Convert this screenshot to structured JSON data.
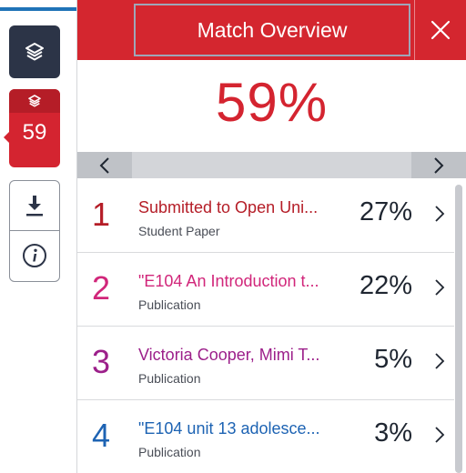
{
  "sidebar": {
    "layers_icon": "layers-icon",
    "score_layers_icon": "layers-icon",
    "score": "59",
    "download_icon": "download-icon",
    "info_icon": "info-icon"
  },
  "header": {
    "title": "Match Overview",
    "close_icon": "close-icon"
  },
  "overall_match": "59%",
  "navigation": {
    "prev_icon": "chevron-left-icon",
    "next_icon": "chevron-right-icon"
  },
  "matches": [
    {
      "rank": "1",
      "title": "Submitted to Open Uni...",
      "type": "Student Paper",
      "percent": "27%",
      "color": "#b51d27"
    },
    {
      "rank": "2",
      "title": "\"E104 An Introduction t...",
      "type": "Publication",
      "percent": "22%",
      "color": "#d1267a"
    },
    {
      "rank": "3",
      "title": "Victoria Cooper, Mimi T...",
      "type": "Publication",
      "percent": "5%",
      "color": "#9c1f8a"
    },
    {
      "rank": "4",
      "title": "\"E104 unit 13 adolesce...",
      "type": "Publication",
      "percent": "3%",
      "color": "#1d63b3"
    }
  ],
  "colors": {
    "brand_red": "#d4262f",
    "toolbar_dark": "#2c3447"
  }
}
